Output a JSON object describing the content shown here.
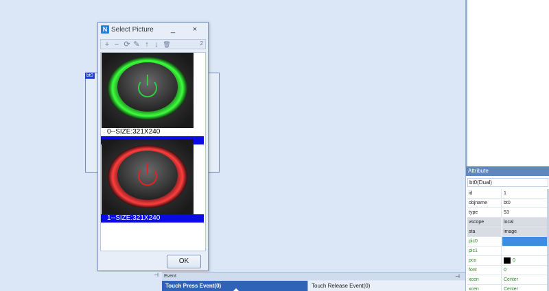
{
  "canvas": {
    "component_tag": "bt0"
  },
  "dialog": {
    "title": "Select Picture",
    "app_icon": "nextion-app-icon",
    "minimize_glyph": "_",
    "close_glyph": "×",
    "toolbar": {
      "add": "+",
      "remove": "−",
      "replace": "⟳",
      "edit": "✎",
      "move_up": "↑",
      "move_down": "↓",
      "delete": "🗑",
      "count": "2"
    },
    "pictures": [
      {
        "caption": "0--SIZE:321X240",
        "color": "#2ecc40",
        "icon": "power-icon-green"
      },
      {
        "caption": "1--SIZE:321X240",
        "color": "#e02424",
        "icon": "power-icon-red"
      }
    ],
    "ok_label": "OK"
  },
  "attribute": {
    "header": "Attribute",
    "selector": "bt0(Dual)",
    "rows": [
      {
        "key": "id",
        "value": "1"
      },
      {
        "key": "objname",
        "value": "bt0"
      },
      {
        "key": "type",
        "value": "53"
      },
      {
        "key": "vscope",
        "value": "local"
      },
      {
        "key": "sta",
        "value": "image"
      },
      {
        "key": "pic0",
        "value": ""
      },
      {
        "key": "pic1",
        "value": ""
      },
      {
        "key": "pco",
        "value": "0"
      },
      {
        "key": "font",
        "value": "0"
      },
      {
        "key": "xcen",
        "value": "Center"
      },
      {
        "key": "xcen",
        "value": "Center"
      }
    ]
  },
  "event": {
    "header": "Event",
    "pin_glyph": "⊣",
    "tabs": [
      {
        "label": "Touch Press Event(0)"
      },
      {
        "label": "Touch Release Event(0)"
      }
    ],
    "dropdown_glyph": "▾"
  }
}
